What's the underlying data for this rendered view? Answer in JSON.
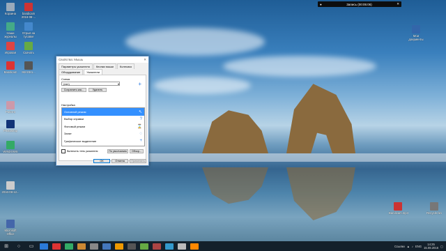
{
  "desktop_icons": [
    {
      "id": "i1",
      "label": "Корзина",
      "color": "#9ab"
    },
    {
      "id": "i2",
      "label": "bandicam 2016-08-...",
      "color": "#c33"
    },
    {
      "id": "i3",
      "label": "Наши журналы",
      "color": "#4a8"
    },
    {
      "id": "i4",
      "label": "Отрыв на тусовке",
      "color": "#48c"
    },
    {
      "id": "i5",
      "label": "Игровая",
      "color": "#d44"
    },
    {
      "id": "i6",
      "label": "Скачать",
      "color": "#6a4"
    },
    {
      "id": "i7",
      "label": "Bandicam",
      "color": "#d33"
    },
    {
      "id": "i8",
      "label": "IMAGE1...",
      "color": "#555"
    },
    {
      "id": "i9",
      "label": "Работа",
      "color": "#c9a"
    },
    {
      "id": "i10",
      "label": "Photoshop",
      "color": "#137"
    },
    {
      "id": "i11",
      "label": "WINDOWS",
      "color": "#3a6"
    },
    {
      "id": "i12",
      "label": "2016-08-12...",
      "color": "#ccc"
    },
    {
      "id": "i13",
      "label": "Microsoft Office",
      "color": "#46a"
    },
    {
      "id": "i14",
      "label": "Мои документы",
      "color": "#36a"
    },
    {
      "id": "i15",
      "label": "Bandicam.mp4",
      "color": "#c33"
    },
    {
      "id": "i16",
      "label": "Recycle bin",
      "color": "#777"
    }
  ],
  "recording": {
    "title": "Запись (00:05:06)",
    "icons": [
      "camera-icon",
      "mic-icon",
      "close-icon"
    ]
  },
  "dialog": {
    "title": "Свойства: Мышь",
    "tabs": [
      "Параметры указателя",
      "Кнопки мыши",
      "Колесико",
      "Оборудование",
      "Указатели"
    ],
    "active_tab": "Указатели",
    "scheme_label": "Схема",
    "scheme_value": "(нет)",
    "save_as": "Сохранить как...",
    "delete": "Удалить",
    "customize_label": "Настройка",
    "items": [
      {
        "name": "Основной режим",
        "cursor": "↖"
      },
      {
        "name": "Выбор справки",
        "cursor": "?"
      },
      {
        "name": "Фоновый режим",
        "cursor": "⌛"
      },
      {
        "name": "Занят",
        "cursor": "◌"
      },
      {
        "name": "Графическое выделение",
        "cursor": "+"
      }
    ],
    "shadow_label": "Включить тень указателя",
    "default_btn": "По умолчанию",
    "browse_btn": "Обзор...",
    "ok": "ОК",
    "cancel": "Отмена",
    "apply": "Применить"
  },
  "taskbar": {
    "apps": [
      "#2b7ad8",
      "#d33",
      "#3a6",
      "#c83",
      "#888",
      "#47b",
      "#e90",
      "#555",
      "#6a4",
      "#a44",
      "#39c",
      "#bbb",
      "#f80"
    ]
  },
  "tray": {
    "lang": "ENG",
    "time": "14:25",
    "date": "15.08.2016",
    "text": "Ссылки"
  }
}
